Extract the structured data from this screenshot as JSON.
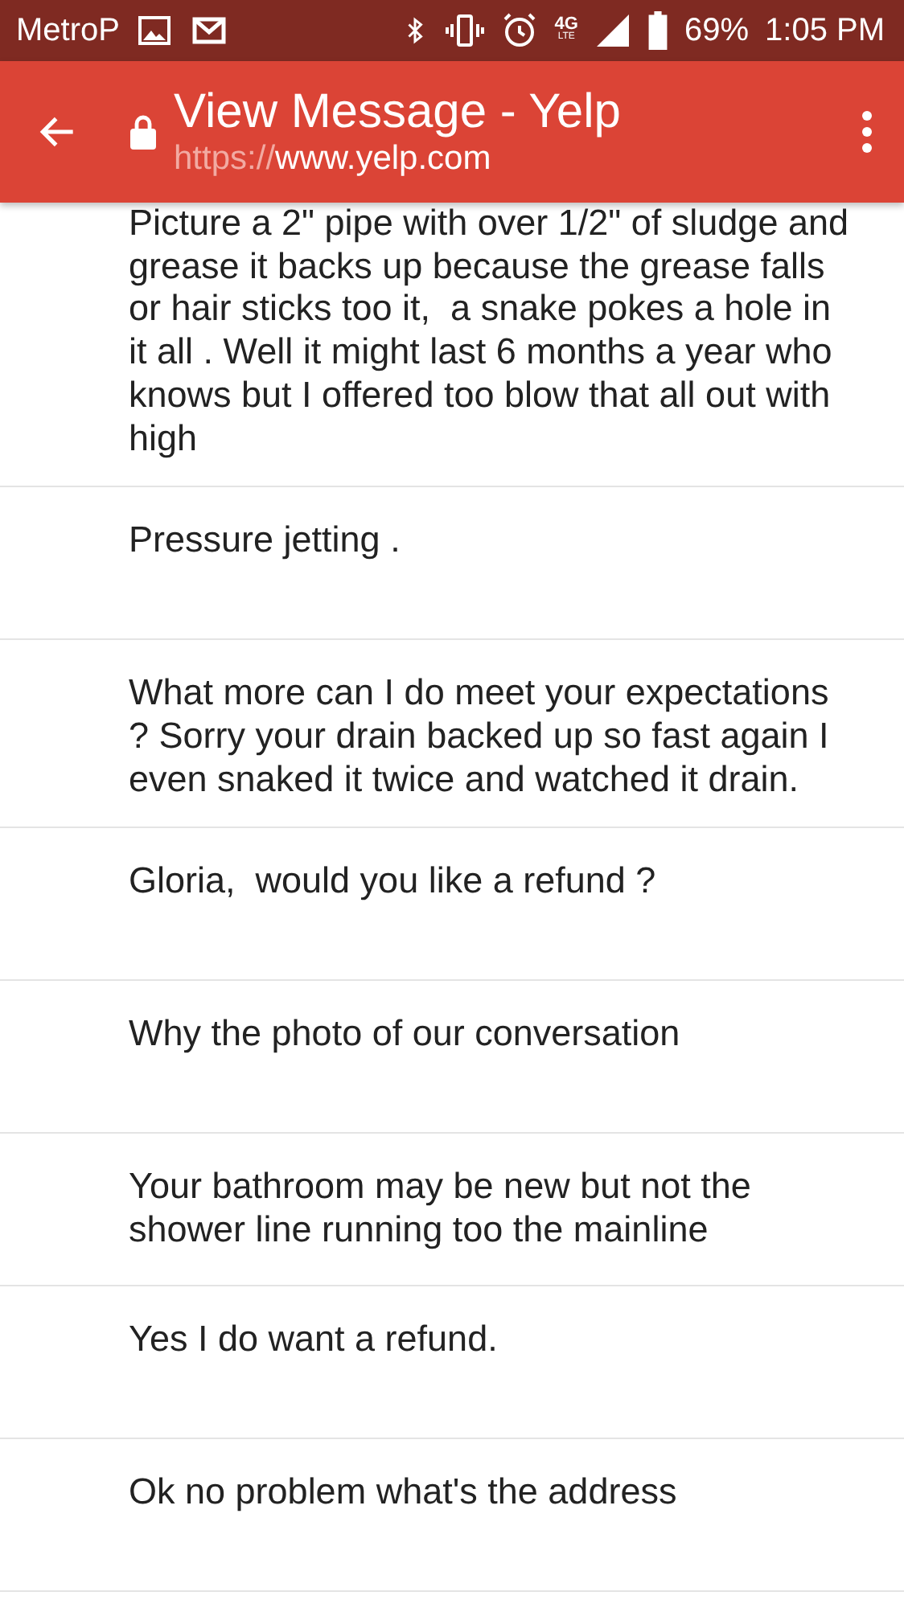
{
  "status_bar": {
    "carrier": "MetroP",
    "network": "4G",
    "network_sub": "LTE",
    "battery": "69%",
    "time": "1:05 PM"
  },
  "toolbar": {
    "title": "View Message - Yelp",
    "url_scheme": "https://",
    "url_host": "www.yelp.com"
  },
  "messages": [
    {
      "text": "Picture a 2\" pipe with over 1/2\" of sludge and grease it backs up because the grease falls or hair sticks too it,  a snake pokes a hole in it all . Well it might last 6 months a year who knows but I offered too blow that all out with high"
    },
    {
      "text": "Pressure jetting ."
    },
    {
      "text": "What more can I do meet your expectations ? Sorry your drain backed up so fast again I even snaked it twice and watched it drain."
    },
    {
      "text": "Gloria,  would you like a refund ?"
    },
    {
      "text": "Why the photo of our conversation"
    },
    {
      "text": "Your bathroom may be new but not the shower line running too the mainline"
    },
    {
      "text": "Yes I do want a refund."
    },
    {
      "text": "Ok no problem what's the address"
    }
  ]
}
